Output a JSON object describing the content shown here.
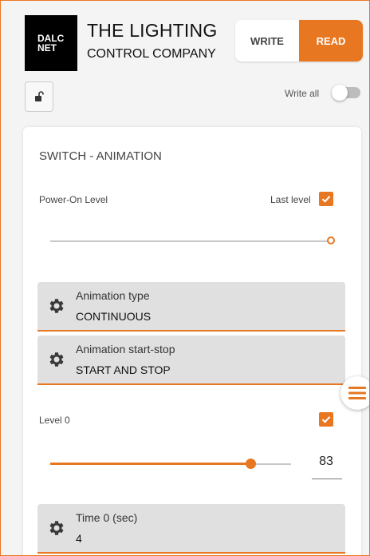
{
  "header": {
    "logo_line1": "DALC",
    "logo_line2": "NET",
    "company_line1": "THE LIGHTING",
    "company_line2": "CONTROL COMPANY",
    "mode_write": "WRITE",
    "mode_read": "READ",
    "mode_selected": "READ"
  },
  "toolbar": {
    "lock_icon": "unlock-icon",
    "write_all_label": "Write all",
    "write_all_on": false
  },
  "card": {
    "title": "SWITCH - ANIMATION",
    "power_on": {
      "label": "Power-On Level",
      "last_level_label": "Last level",
      "last_level_checked": true,
      "slider_level_fraction": 1.0
    },
    "animation_type": {
      "label": "Animation type",
      "value": "CONTINUOUS",
      "icon": "gear-icon"
    },
    "animation_start_stop": {
      "label": "Animation start-stop",
      "value": "START AND STOP",
      "icon": "gear-icon"
    },
    "level0": {
      "label": "Level 0",
      "checked": true,
      "value": "83",
      "slider_level_fraction": 0.83
    },
    "time0": {
      "label": "Time 0 (sec)",
      "value": "4",
      "icon": "gear-icon"
    }
  },
  "colors": {
    "accent": "#e87722"
  },
  "menu_icon": "hamburger-menu-icon"
}
